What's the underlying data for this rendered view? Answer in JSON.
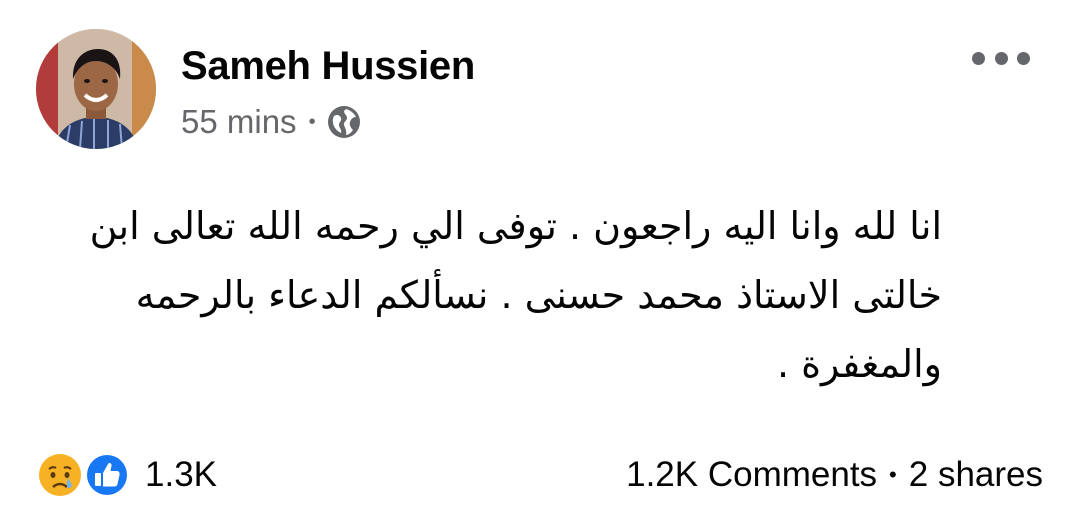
{
  "post": {
    "author": "Sameh Hussien",
    "timestamp": "55 mins",
    "separator": "•",
    "audience_icon": "globe-icon",
    "text": "انا لله وانا اليه راجعون . توفى الي رحمه الله تعالى ابن خالتى الاستاذ محمد حسنى . نسألكم الدعاء بالرحمه والمغفرة ."
  },
  "reactions": {
    "icons": [
      "sad-reaction-icon",
      "like-reaction-icon"
    ],
    "count": "1.3K"
  },
  "stats": {
    "comments": "1.2K Comments",
    "separator": "•",
    "shares": "2 shares"
  },
  "colors": {
    "text": "#050505",
    "secondary_text": "#65676b",
    "like_blue": "#1877f2",
    "sad_yellow": "#f7b125"
  }
}
